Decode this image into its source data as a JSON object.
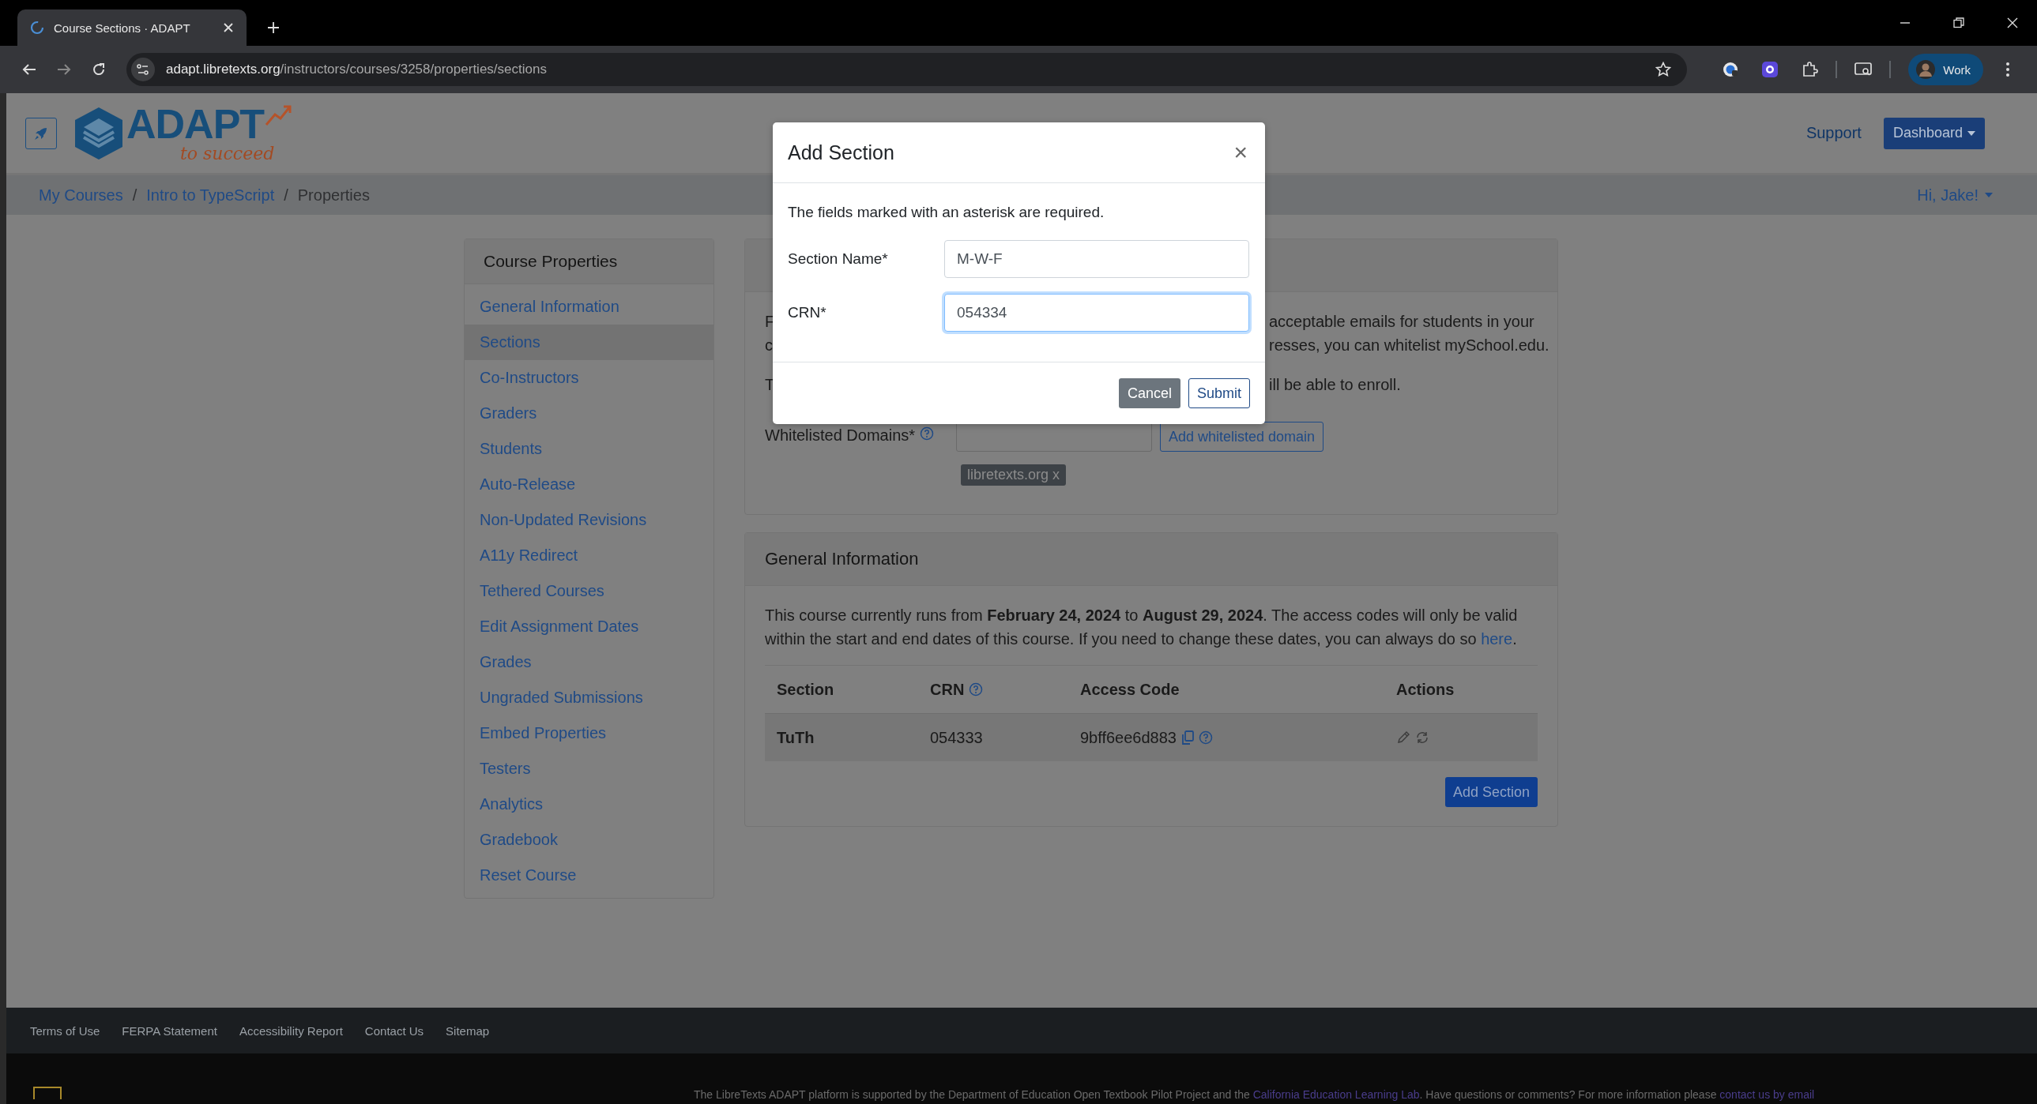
{
  "browser": {
    "tab_title": "Course Sections · ADAPT",
    "url_host": "adapt.libretexts.org",
    "url_path": "/instructors/courses/3258/properties/sections",
    "profile_label": "Work"
  },
  "header": {
    "logo_name": "ADAPT",
    "logo_tagline": "to succeed",
    "support": "Support",
    "dashboard": "Dashboard",
    "greeting": "Hi, Jake!"
  },
  "breadcrumb": [
    {
      "label": "My Courses",
      "kind": "link"
    },
    {
      "separator": "/",
      "label": "Intro to TypeScript",
      "kind": "link"
    },
    {
      "separator": "/",
      "label": "Properties",
      "kind": "current"
    }
  ],
  "sidebar": {
    "title": "Course Properties",
    "items": [
      {
        "label": "General Information",
        "selected": false
      },
      {
        "label": "Sections",
        "selected": true
      },
      {
        "label": "Co-Instructors",
        "selected": false
      },
      {
        "label": "Graders",
        "selected": false
      },
      {
        "label": "Students",
        "selected": false
      },
      {
        "label": "Auto-Release",
        "selected": false
      },
      {
        "label": "Non-Updated Revisions",
        "selected": false
      },
      {
        "label": "A11y Redirect",
        "selected": false
      },
      {
        "label": "Tethered Courses",
        "selected": false
      },
      {
        "label": "Edit Assignment Dates",
        "selected": false
      },
      {
        "label": "Grades",
        "selected": false
      },
      {
        "label": "Ungraded Submissions",
        "selected": false
      },
      {
        "label": "Embed Properties",
        "selected": false
      },
      {
        "label": "Testers",
        "selected": false
      },
      {
        "label": "Analytics",
        "selected": false
      },
      {
        "label": "Gradebook",
        "selected": false
      },
      {
        "label": "Reset Course",
        "selected": false
      }
    ]
  },
  "whitelist_card": {
    "lines": [
      {
        "left": "F",
        "right": "acceptable emails for students in your"
      },
      {
        "left": "c",
        "right": "resses, you can whitelist mySchool.edu."
      }
    ],
    "note": {
      "left": "T",
      "right": "ill be able to enroll."
    },
    "domains_label": "Whitelisted Domains*",
    "add_button": "Add whitelisted domain",
    "tags": [
      {
        "label": "libretexts.org x"
      }
    ]
  },
  "general_card": {
    "title": "General Information",
    "description": "This course currently runs from **February 24, 2024** to **August 29, 2024**. The access codes will only be valid within the start and end dates of this course. If you need to change these dates, you can always do so",
    "link": "here",
    "description_end": ".",
    "columns": [
      {
        "label": "Section",
        "help": false
      },
      {
        "label": "CRN",
        "help": true
      },
      {
        "label": "Access Code",
        "help": false
      },
      {
        "label": "Actions",
        "help": false
      }
    ],
    "rows": [
      {
        "section": "TuTh",
        "crn": "054333",
        "access_code": "9bff6ee6d883"
      }
    ],
    "add_button": "Add Section"
  },
  "modal": {
    "title": "Add Section",
    "close": "×",
    "note": "The fields marked with an asterisk are required.",
    "fields": [
      {
        "label": "Section Name*",
        "value": "M-W-F",
        "focused": false
      },
      {
        "label": "CRN*",
        "value": "054334",
        "focused": true
      }
    ],
    "buttons": [
      {
        "label": "Cancel",
        "kind": "secondary"
      },
      {
        "label": "Submit",
        "kind": "outline"
      }
    ]
  },
  "footer": {
    "links": [
      "Terms of Use",
      "FERPA Statement",
      "Accessibility Report",
      "Contact Us",
      "Sitemap"
    ],
    "notice": "The LibreTexts ADAPT platform is supported by the Department of Education Open Textbook Pilot Project and the",
    "notice_link": "California Education Learning Lab",
    "notice_tail": ". Have questions or comments? For more information please",
    "notice_link2": "contact us by email"
  }
}
